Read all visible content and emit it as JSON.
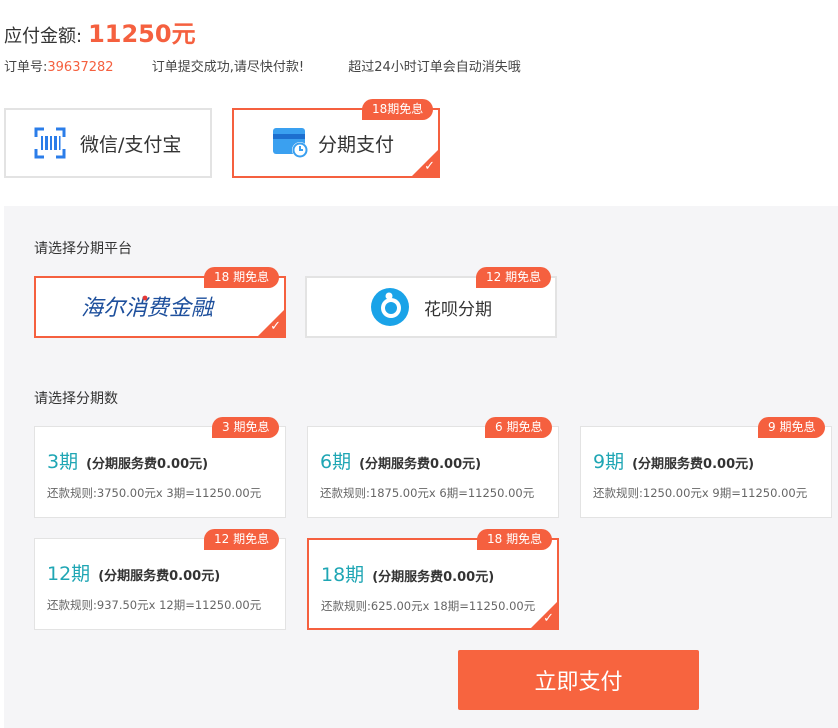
{
  "header": {
    "amount_label": "应付金额:",
    "amount_value": "11250元",
    "order_label": "订单号:",
    "order_number": "39637282",
    "success_msg": "订单提交成功,请尽快付款!",
    "expire_msg": "超过24小时订单会自动消失哦"
  },
  "pay_methods": [
    {
      "label": "微信/支付宝",
      "icon": "scan-icon",
      "selected": false
    },
    {
      "label": "分期支付",
      "icon": "card-clock-icon",
      "badge": "18期免息",
      "selected": true
    }
  ],
  "platform_section": {
    "title": "请选择分期平台",
    "items": [
      {
        "label": "海尔消费金融",
        "icon": "haier-consumer-finance-logo",
        "badge": "18 期免息",
        "selected": true
      },
      {
        "label": "花呗分期",
        "icon": "huabei-logo",
        "badge": "12 期免息",
        "selected": false
      }
    ]
  },
  "term_section": {
    "title": "请选择分期数",
    "items": [
      {
        "term": "3期",
        "fee": "(分期服务费0.00元)",
        "rule": "还款规则:3750.00元x 3期=11250.00元",
        "badge": "3 期免息",
        "selected": false
      },
      {
        "term": "6期",
        "fee": "(分期服务费0.00元)",
        "rule": "还款规则:1875.00元x 6期=11250.00元",
        "badge": "6 期免息",
        "selected": false
      },
      {
        "term": "9期",
        "fee": "(分期服务费0.00元)",
        "rule": "还款规则:1250.00元x 9期=11250.00元",
        "badge": "9 期免息",
        "selected": false
      },
      {
        "term": "12期",
        "fee": "(分期服务费0.00元)",
        "rule": "还款规则:937.50元x 12期=11250.00元",
        "badge": "12 期免息",
        "selected": false
      },
      {
        "term": "18期",
        "fee": "(分期服务费0.00元)",
        "rule": "还款规则:625.00元x 18期=11250.00元",
        "badge": "18 期免息",
        "selected": true
      }
    ]
  },
  "pay_button": "立即支付",
  "colors": {
    "accent": "#f5603f",
    "term_text": "#1fa6b4",
    "panel_bg": "#f5f5f7"
  }
}
